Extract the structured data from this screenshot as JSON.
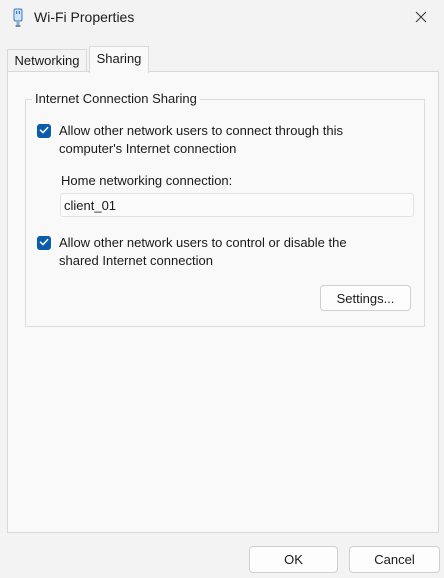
{
  "window": {
    "title": "Wi-Fi Properties",
    "icon": "network-adapter-icon"
  },
  "tabs": [
    {
      "label": "Networking",
      "selected": false
    },
    {
      "label": "Sharing",
      "selected": true
    }
  ],
  "sharing": {
    "group_title": "Internet Connection Sharing",
    "allow_connect": {
      "checked": true,
      "label": "Allow other network users to connect through this computer's Internet connection"
    },
    "home_connection": {
      "label": "Home networking connection:",
      "value": "client_01"
    },
    "allow_control": {
      "checked": true,
      "label": "Allow other network users to control or disable the shared Internet connection"
    },
    "settings_label": "Settings..."
  },
  "footer": {
    "ok_label": "OK",
    "cancel_label": "Cancel"
  },
  "colors": {
    "accent": "#0b5cad",
    "window_bg": "#f3f3f3",
    "panel_bg": "#f9f9f9"
  }
}
